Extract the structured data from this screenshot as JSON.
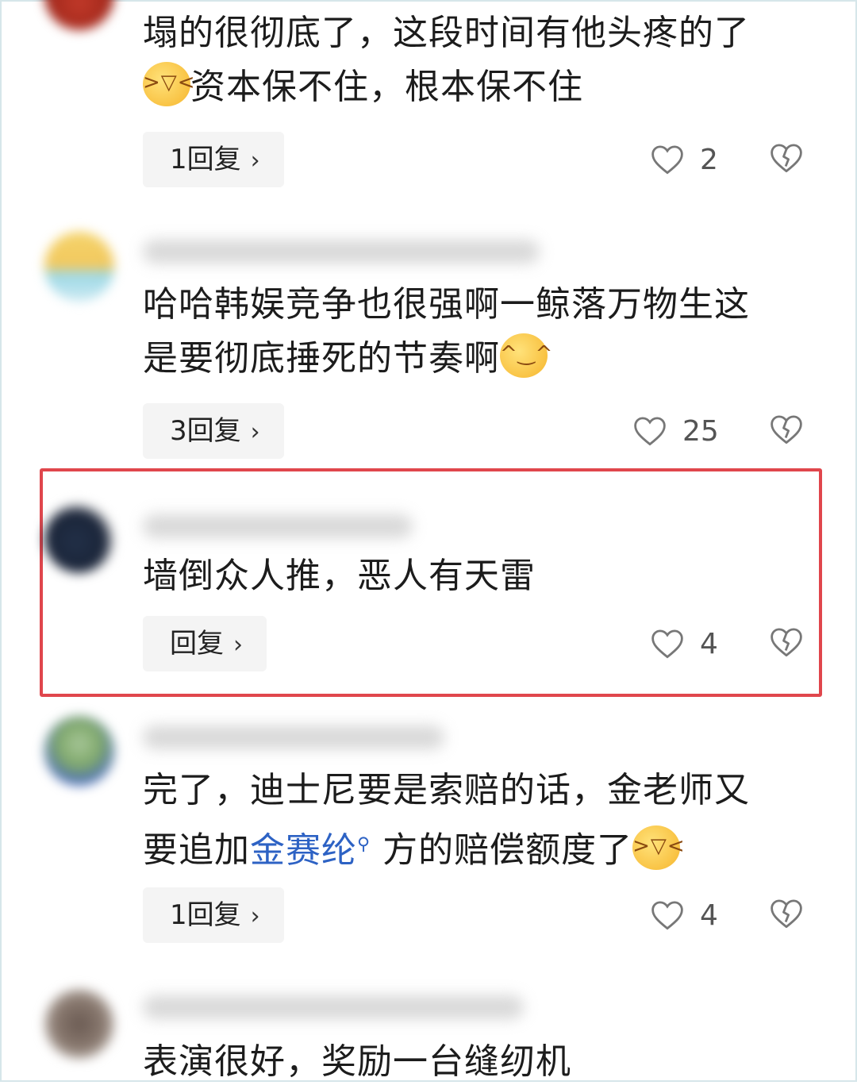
{
  "comments": [
    {
      "lines": [
        "塌的很彻底了，这段时间有他头疼的了",
        "资本保不住，根本保不住"
      ],
      "emoji": "laughing-crying-emoji",
      "reply_label": "1回复",
      "like_count": "2"
    },
    {
      "lines": [
        "哈哈韩娱竞争也很强啊一鲸落万物生这",
        "是要彻底捶死的节奏啊"
      ],
      "emoji": "hand-over-mouth-emoji",
      "reply_label": "3回复",
      "like_count": "25"
    },
    {
      "lines": [
        "墙倒众人推，恶人有天雷"
      ],
      "reply_label": "回复",
      "like_count": "4",
      "highlighted": true
    },
    {
      "lines": [
        "完了，迪士尼要是索赔的话，金老师又"
      ],
      "line2_before": "要追加",
      "link_text": "金赛纶",
      "line2_after": "方的赔偿额度了",
      "emoji": "laughing-crying-emoji",
      "reply_label": "1回复",
      "like_count": "4"
    },
    {
      "lines": [
        "表演很好，奖励一台缝纫机"
      ]
    }
  ],
  "colors": {
    "highlight_border": "#e0464c",
    "link": "#2d62c4",
    "reply_bg": "#f4f4f4"
  },
  "icons": {
    "like": "heart-outline-icon",
    "dislike": "broken-heart-icon",
    "chevron": "chevron-right-icon",
    "link_search": "search-icon"
  }
}
